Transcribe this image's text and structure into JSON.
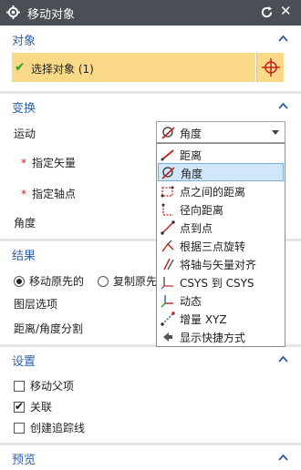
{
  "window": {
    "title": "移动对象",
    "close_glyph": "✕"
  },
  "object_section": {
    "title": "对象",
    "select_label": "选择对象 (1)"
  },
  "transform_section": {
    "title": "变换",
    "motion_label": "运动",
    "motion_value": "角度",
    "vector_label": "指定矢量",
    "axis_point_label": "指定轴点",
    "angle_label": "角度",
    "required_mark": "*"
  },
  "motion_options": [
    {
      "label": "距离",
      "icon": "distance-icon"
    },
    {
      "label": "角度",
      "icon": "angle-icon",
      "selected": true
    },
    {
      "label": "点之间的距离",
      "icon": "point-distance-icon"
    },
    {
      "label": "径向距离",
      "icon": "radial-distance-icon"
    },
    {
      "label": "点到点",
      "icon": "point-to-point-icon"
    },
    {
      "label": "根据三点旋转",
      "icon": "three-point-rotate-icon"
    },
    {
      "label": "将轴与矢量对齐",
      "icon": "align-axis-icon"
    },
    {
      "label": "CSYS 到 CSYS",
      "icon": "csys-icon"
    },
    {
      "label": "动态",
      "icon": "dynamic-icon"
    },
    {
      "label": "增量 XYZ",
      "icon": "delta-xyz-icon"
    },
    {
      "label": "显示快捷方式",
      "icon": "shortcut-arrow-icon"
    }
  ],
  "result_section": {
    "title": "结果",
    "move_original": "移动原先的",
    "copy_original": "复制原先的",
    "layer_option": "图层选项",
    "distance_angle_split": "距离/角度分割"
  },
  "settings_section": {
    "title": "设置",
    "move_parent": "移动父项",
    "associative": "关联",
    "create_trace": "创建追踪线",
    "associative_checked": true
  },
  "preview_section": {
    "title": "预览"
  },
  "colors": {
    "accent": "#2e5fa8",
    "titlebar": "#4a4f55",
    "selection": "#f9d987",
    "required": "#c32020"
  }
}
